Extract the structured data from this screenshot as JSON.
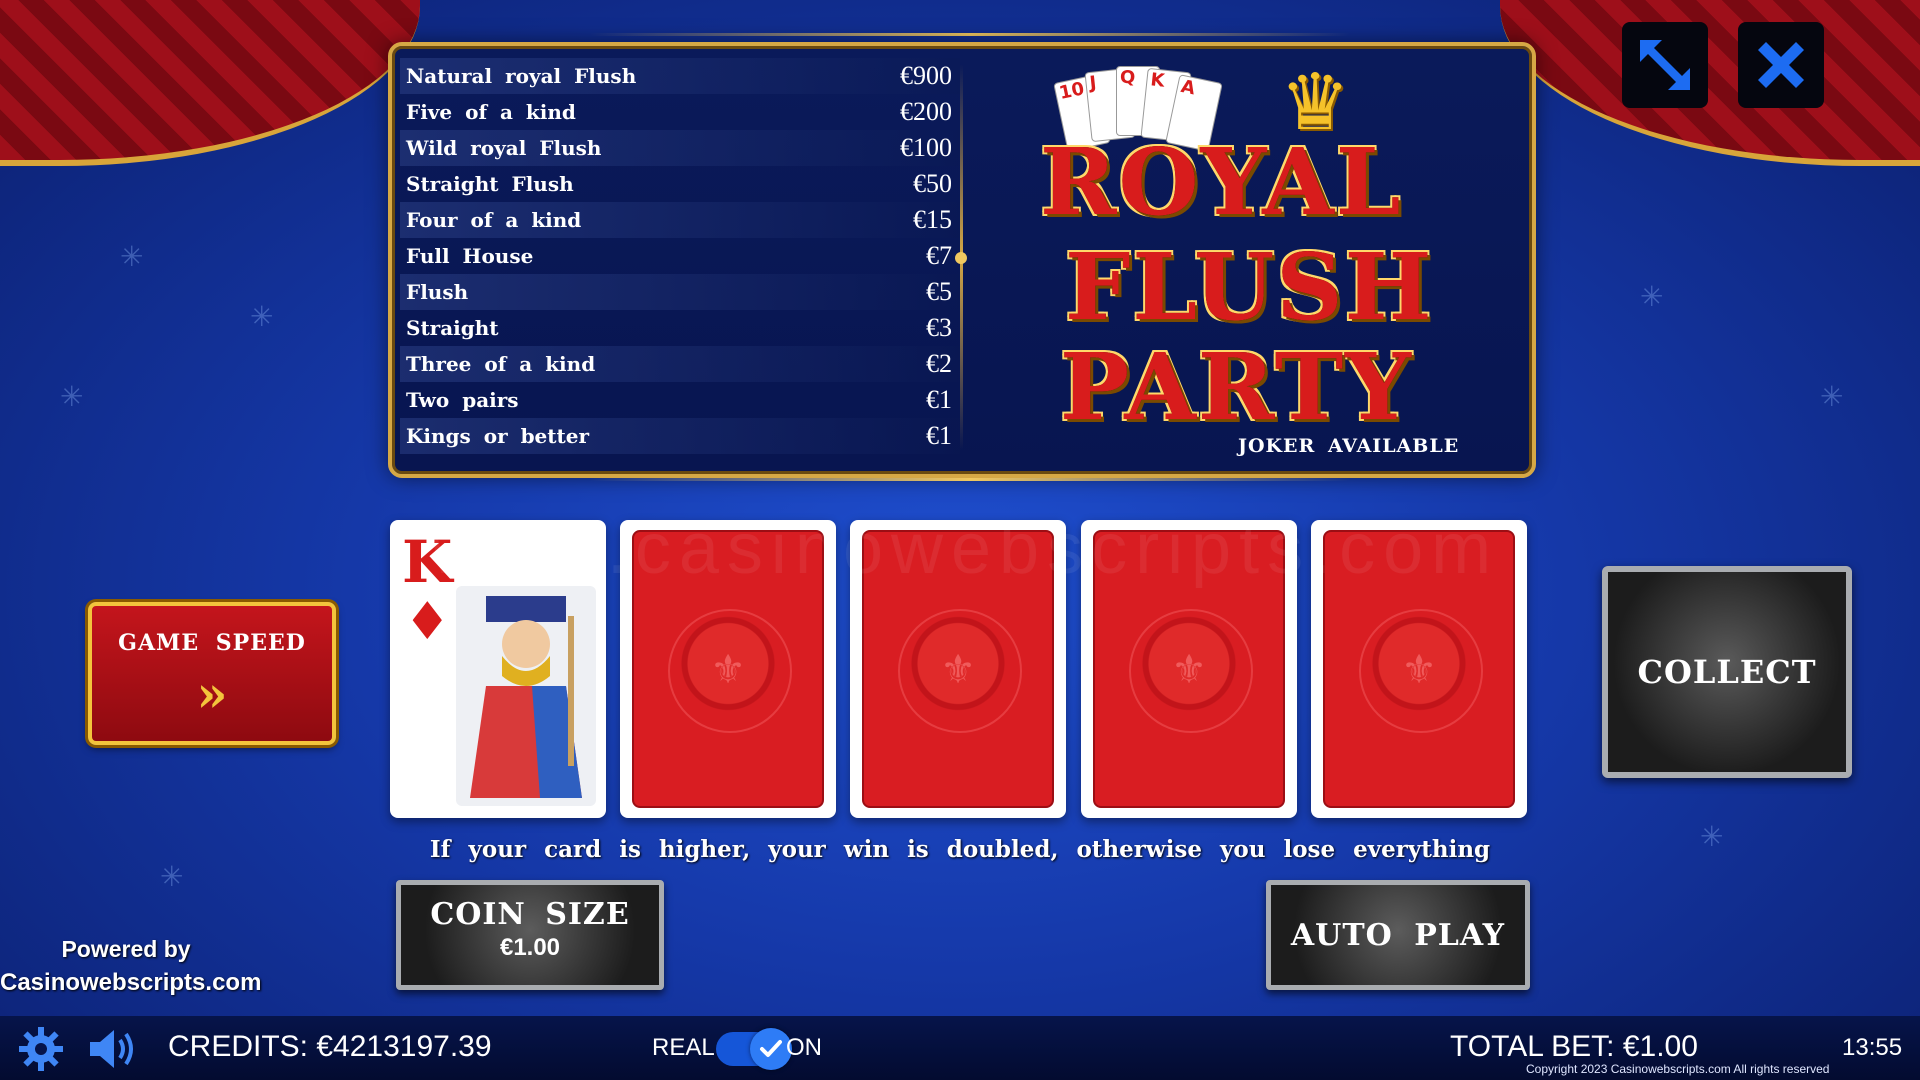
{
  "paytable": [
    {
      "hand": "Natural royal Flush",
      "payout": "€900"
    },
    {
      "hand": "Five of a kind",
      "payout": "€200"
    },
    {
      "hand": "Wild royal Flush",
      "payout": "€100"
    },
    {
      "hand": "Straight Flush",
      "payout": "€50"
    },
    {
      "hand": "Four of a kind",
      "payout": "€15"
    },
    {
      "hand": "Full House",
      "payout": "€7"
    },
    {
      "hand": "Flush",
      "payout": "€5"
    },
    {
      "hand": "Straight",
      "payout": "€3"
    },
    {
      "hand": "Three of a kind",
      "payout": "€2"
    },
    {
      "hand": "Two pairs",
      "payout": "€1"
    },
    {
      "hand": "Kings or better",
      "payout": "€1"
    }
  ],
  "logo": {
    "line1": "ROYAL",
    "line2": "FLUSH",
    "line3": "PARTY",
    "tagline": "JOKER AVAILABLE",
    "mini_cards": [
      "10",
      "J",
      "Q",
      "K",
      "A"
    ]
  },
  "watermark": "www.casinowebscripts.com",
  "cards": {
    "face_up": {
      "rank": "K",
      "suit": "♦",
      "suit_name": "diamonds"
    },
    "face_down_count": 4
  },
  "buttons": {
    "game_speed": "GAME SPEED",
    "collect": "COLLECT",
    "coin_size_label": "COIN SIZE",
    "coin_size_value": "€1.00",
    "auto_play": "AUTO PLAY"
  },
  "message": "If your card is higher, your win is doubled, otherwise you lose everything",
  "powered": {
    "line1": "Powered by",
    "line2": "Casinowebscripts.com"
  },
  "bottom_bar": {
    "credits": "CREDITS: €4213197.39",
    "real_label": "REAL",
    "toggle_state": "on",
    "on_label": "ON",
    "total_bet": "TOTAL BET: €1.00",
    "clock": "13:55",
    "copyright": "Copyright 2023 Casinowebscripts.com All rights reserved"
  },
  "colors": {
    "background": "#1538a8",
    "accent_gold": "#d6a845",
    "card_red": "#d81c1c",
    "toggle_blue": "#1556d8"
  },
  "icons": {
    "fullscreen": "fullscreen-arrows-icon",
    "close": "close-x-icon",
    "settings": "gear-icon",
    "sound": "speaker-icon",
    "toggle_check": "check-icon"
  }
}
